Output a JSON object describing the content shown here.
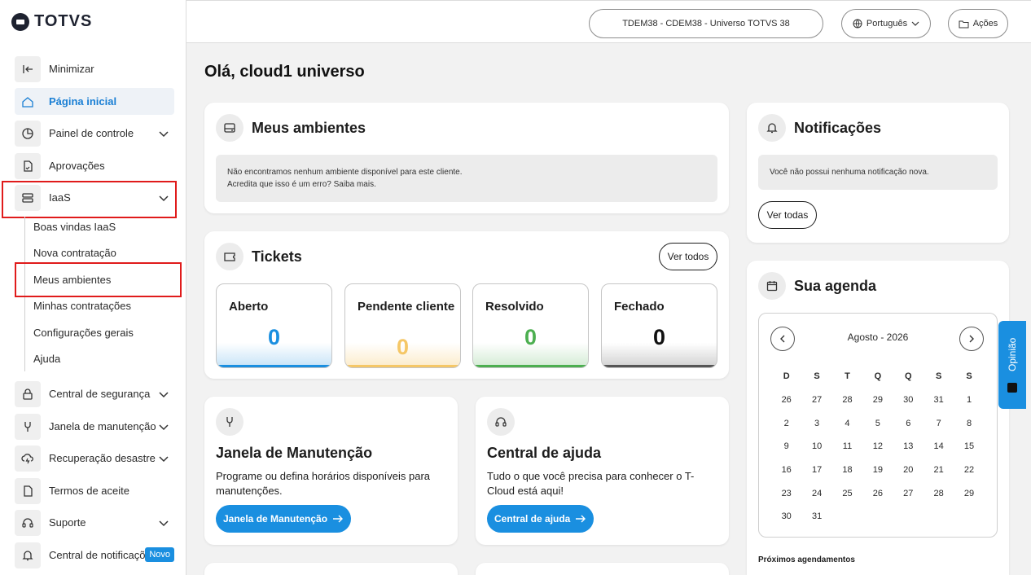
{
  "brand": {
    "logo_text": "TOTVS"
  },
  "topbar": {
    "environment": "TDEM38 - CDEM38 - Universo TOTVS 38",
    "language": "Português",
    "actions": "Ações"
  },
  "sidebar": {
    "minimize": "Minimizar",
    "home": "Página inicial",
    "dashboard": "Painel de controle",
    "approvals": "Aprovações",
    "iaas": "IaaS",
    "iaas_sub": {
      "welcome": "Boas vindas IaaS",
      "new_contract": "Nova contratação",
      "my_envs": "Meus ambientes",
      "my_contracts": "Minhas contratações",
      "settings": "Configurações gerais",
      "help": "Ajuda"
    },
    "security": "Central de segurança",
    "maintenance": "Janela de manutenção",
    "recovery": "Recuperação desastre",
    "terms": "Termos de aceite",
    "support": "Suporte",
    "notif_center": "Central de notificações",
    "new_badge": "Novo"
  },
  "main": {
    "greeting": "Olá, cloud1 universo",
    "environments": {
      "title": "Meus ambientes",
      "line1": "Não encontramos nenhum ambiente disponível para este cliente.",
      "line2": "Acredita que isso é um erro? Saiba mais."
    },
    "tickets": {
      "title": "Tickets",
      "see_all": "Ver todos",
      "items": [
        {
          "label": "Aberto",
          "value": "0",
          "color": "#1a8fe0"
        },
        {
          "label": "Pendente cliente",
          "value": "0",
          "color": "#f5c766"
        },
        {
          "label": "Resolvido",
          "value": "0",
          "color": "#4caf50"
        },
        {
          "label": "Fechado",
          "value": "0",
          "color": "#111111"
        }
      ]
    },
    "maintenance_card": {
      "title": "Janela de Manutenção",
      "desc": "Programe ou defina horários disponíveis para manutenções.",
      "button": "Janela de Manutenção"
    },
    "help_card": {
      "title": "Central de ajuda",
      "desc": "Tudo o que você precisa para conhecer o T-Cloud está aqui!",
      "button": "Central de ajuda"
    },
    "notifications": {
      "title": "Notificações",
      "empty": "Você não possui nenhuma notificação nova.",
      "see_all": "Ver todas"
    },
    "agenda": {
      "title": "Sua agenda",
      "month": "Agosto - 2026",
      "weekdays": [
        "D",
        "S",
        "T",
        "Q",
        "Q",
        "S",
        "S"
      ],
      "days": [
        "26",
        "27",
        "28",
        "29",
        "30",
        "31",
        "1",
        "2",
        "3",
        "4",
        "5",
        "6",
        "7",
        "8",
        "9",
        "10",
        "11",
        "12",
        "13",
        "14",
        "15",
        "16",
        "17",
        "18",
        "19",
        "20",
        "21",
        "22",
        "23",
        "24",
        "25",
        "26",
        "27",
        "28",
        "29",
        "30",
        "31"
      ],
      "upcoming": "Próximos agendamentos"
    }
  },
  "feedback": {
    "label": "Opinião"
  }
}
